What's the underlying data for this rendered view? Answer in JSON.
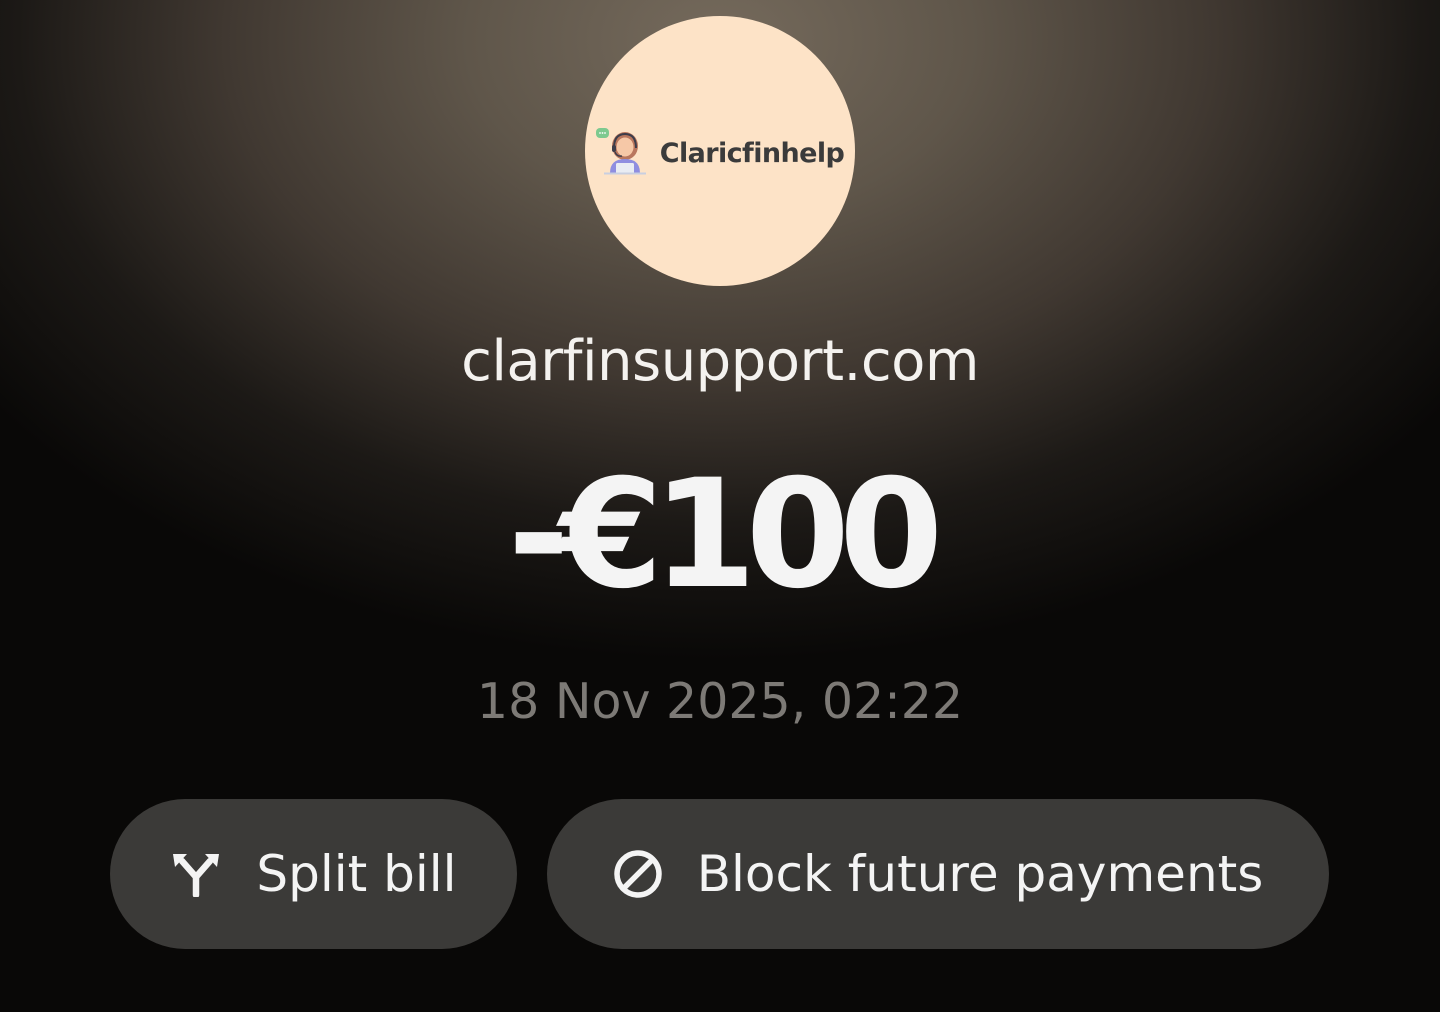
{
  "merchant": {
    "logo_text": "Claricfinhelp",
    "logo_icon": "support-agent-icon",
    "logo_bg_color": "#fde3c7",
    "name": "clarfinsupport.com"
  },
  "transaction": {
    "amount": "-€100",
    "datetime": "18 Nov 2025, 02:22"
  },
  "actions": {
    "split_bill": {
      "label": "Split bill",
      "icon": "split-arrows-icon"
    },
    "block_payments": {
      "label": "Block future payments",
      "icon": "block-icon"
    }
  },
  "colors": {
    "button_bg": "#3b3a38",
    "amount_text": "#f4f4f4",
    "date_text": "#7d7a76"
  }
}
